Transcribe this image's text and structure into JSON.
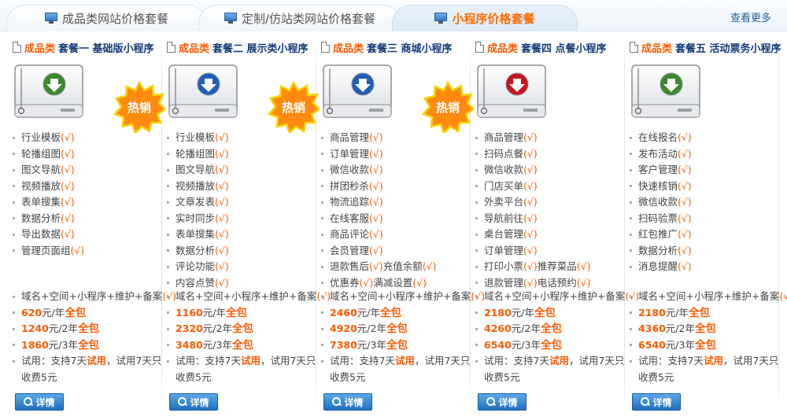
{
  "tabs": [
    {
      "label": "成品类网站价格套餐",
      "active": false
    },
    {
      "label": "定制/仿站类网站价格套餐",
      "active": false
    },
    {
      "label": "小程序价格套餐",
      "active": true
    }
  ],
  "more_link": "查看更多",
  "colors": {
    "accent": "#ff5a00",
    "title": "#123a7a",
    "button": "#1f6fc0"
  },
  "hot_badge": "热销",
  "detail_label": "详情",
  "check_mark": "(√)",
  "packages": [
    {
      "title_accent": "成品类",
      "title_rest": "套餐一 基础版小程序",
      "icon_color": "#3a8a2a",
      "hot": true,
      "features": [
        "行业模板",
        "轮播组图",
        "图文导航",
        "视频播放",
        "表单搜集",
        "数据分析",
        "导出数据",
        "管理页面组"
      ],
      "service": "域名+空间+小程序+维护+备案",
      "prices": [
        {
          "amount": "620",
          "unit": "元/年",
          "deal": "全包"
        },
        {
          "amount": "1240",
          "unit": "元/2年",
          "deal": "全包"
        },
        {
          "amount": "1860",
          "unit": "元/3年",
          "deal": "全包"
        }
      ],
      "trial_pre": "试用：支持7天",
      "trial_hl": "试用",
      "trial_post": "，试用7天只收费5元"
    },
    {
      "title_accent": "成品类",
      "title_rest": "套餐二 展示类小程序",
      "icon_color": "#1f5fb8",
      "hot": true,
      "features": [
        "行业模板",
        "轮播组图",
        "图文导航",
        "视频播放",
        "文章发表",
        "实时同步",
        "表单搜集",
        "数据分析",
        "评论功能",
        "内容点赞"
      ],
      "service": "域名+空间+小程序+维护+备案",
      "prices": [
        {
          "amount": "1160",
          "unit": "元/年",
          "deal": "全包"
        },
        {
          "amount": "2320",
          "unit": "元/2年",
          "deal": "全包"
        },
        {
          "amount": "3480",
          "unit": "元/3年",
          "deal": "全包"
        }
      ],
      "trial_pre": "试用：支持7天",
      "trial_hl": "试用",
      "trial_post": "，试用7天只收费5元"
    },
    {
      "title_accent": "成品类",
      "title_rest": "套餐三 商城小程序",
      "icon_color": "#1f5fb8",
      "hot": true,
      "features": [
        "商品管理",
        "订单管理",
        "微信收款",
        "拼团秒杀",
        "物流追踪",
        "在线客服",
        "商品评论",
        "会员管理"
      ],
      "features_pair": [
        {
          "a": "退款售后",
          "b": "充值余额"
        },
        {
          "a": "优惠券",
          "b": "满减设置"
        }
      ],
      "service": "域名+空间+小程序+维护+备案",
      "prices": [
        {
          "amount": "2460",
          "unit": "元/年",
          "deal": "全包"
        },
        {
          "amount": "4920",
          "unit": "元/2年",
          "deal": "全包"
        },
        {
          "amount": "7380",
          "unit": "元/3年",
          "deal": "全包"
        }
      ],
      "trial_pre": "试用：支持7天",
      "trial_hl": "试用",
      "trial_post": "，试用7天只收费5元"
    },
    {
      "title_accent": "成品类",
      "title_rest": "套餐四 点餐小程序",
      "icon_color": "#c8141e",
      "hot": false,
      "features": [
        "商品管理",
        "扫码点餐",
        "微信收款",
        "门店买单",
        "外卖平台",
        "导航前往",
        "桌台管理",
        "订单管理"
      ],
      "features_pair": [
        {
          "a": "打印小票",
          "b": "推荐菜品"
        },
        {
          "a": "退款管理",
          "b": "电话预约"
        }
      ],
      "service": "域名+空间+小程序+维护+备案",
      "prices": [
        {
          "amount": "2180",
          "unit": "元/年",
          "deal": "全包"
        },
        {
          "amount": "4260",
          "unit": "元/2年",
          "deal": "全包"
        },
        {
          "amount": "6540",
          "unit": "元/3年",
          "deal": "全包"
        }
      ],
      "trial_pre": "试用：支持7天",
      "trial_hl": "试用",
      "trial_post": "，试用7天只收费5元"
    },
    {
      "title_accent": "成品类",
      "title_rest": "套餐五 活动票务小程序",
      "icon_color": "#3a8a2a",
      "hot": false,
      "features": [
        "在线报名",
        "发布活动",
        "客户管理",
        "快速核销",
        "微信收款",
        "扫码验票",
        "红包推广",
        "数据分析",
        "消息提醒"
      ],
      "service": "域名+空间+小程序+维护+备案",
      "prices": [
        {
          "amount": "2180",
          "unit": "元/年",
          "deal": "全包"
        },
        {
          "amount": "4360",
          "unit": "元/2年",
          "deal": "全包"
        },
        {
          "amount": "6540",
          "unit": "元/3年",
          "deal": "全包"
        }
      ],
      "trial_pre": "试用：支持7天",
      "trial_hl": "试用",
      "trial_post": "，试用7天只收费5元"
    }
  ]
}
